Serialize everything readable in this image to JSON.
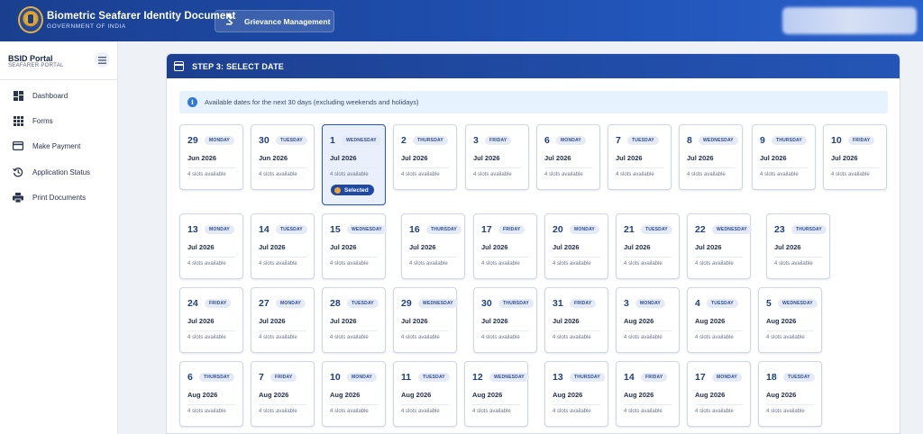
{
  "header": {
    "title": "Biometric Seafarer Identity Document",
    "subtitle": "GOVERNMENT OF INDIA",
    "grievance_label": "Grievance Management"
  },
  "sidebar": {
    "portal_name": "BSID Portal",
    "portal_sub": "SEAFARER PORTAL",
    "items": [
      {
        "label": "Dashboard",
        "icon": "dashboard-icon"
      },
      {
        "label": "Forms",
        "icon": "grid-icon"
      },
      {
        "label": "Make Payment",
        "icon": "credit-card-icon"
      },
      {
        "label": "Application Status",
        "icon": "history-icon"
      },
      {
        "label": "Print Documents",
        "icon": "printer-icon"
      }
    ]
  },
  "main": {
    "step_title": "STEP 3: SELECT DATE",
    "info_text": "Available dates for the next 30 days (excluding weekends and holidays)",
    "selected_label": "Selected",
    "accent_color": "#1f4aa3",
    "dates": [
      {
        "day": "29",
        "weekday": "MONDAY",
        "month": "Jun 2026",
        "slots": "4 slots available"
      },
      {
        "day": "30",
        "weekday": "TUESDAY",
        "month": "Jun 2026",
        "slots": "4 slots available"
      },
      {
        "day": "1",
        "weekday": "WEDNESDAY",
        "month": "Jul 2026",
        "slots": "4 slots available",
        "selected": true
      },
      {
        "day": "2",
        "weekday": "THURSDAY",
        "month": "Jul 2026",
        "slots": "4 slots available"
      },
      {
        "day": "3",
        "weekday": "FRIDAY",
        "month": "Jul 2026",
        "slots": "4 slots available"
      },
      {
        "day": "6",
        "weekday": "MONDAY",
        "month": "Jul 2026",
        "slots": "4 slots available"
      },
      {
        "day": "7",
        "weekday": "TUESDAY",
        "month": "Jul 2026",
        "slots": "4 slots available"
      },
      {
        "day": "8",
        "weekday": "WEDNESDAY",
        "month": "Jul 2026",
        "slots": "4 slots available"
      },
      {
        "day": "9",
        "weekday": "THURSDAY",
        "month": "Jul 2026",
        "slots": "4 slots available"
      },
      {
        "day": "10",
        "weekday": "FRIDAY",
        "month": "Jul 2026",
        "slots": "4 slots available"
      },
      {
        "day": "13",
        "weekday": "MONDAY",
        "month": "Jul 2026",
        "slots": "4 slots available"
      },
      {
        "day": "14",
        "weekday": "TUESDAY",
        "month": "Jul 2026",
        "slots": "4 slots available"
      },
      {
        "day": "15",
        "weekday": "WEDNESDAY",
        "month": "Jul 2026",
        "slots": "4 slots available"
      },
      {
        "day": "16",
        "weekday": "THURSDAY",
        "month": "Jul 2026",
        "slots": "4 slots available"
      },
      {
        "day": "17",
        "weekday": "FRIDAY",
        "month": "Jul 2026",
        "slots": "4 slots available"
      },
      {
        "day": "20",
        "weekday": "MONDAY",
        "month": "Jul 2026",
        "slots": "4 slots available"
      },
      {
        "day": "21",
        "weekday": "TUESDAY",
        "month": "Jul 2026",
        "slots": "4 slots available"
      },
      {
        "day": "22",
        "weekday": "WEDNESDAY",
        "month": "Jul 2026",
        "slots": "4 slots available"
      },
      {
        "day": "23",
        "weekday": "THURSDAY",
        "month": "Jul 2026",
        "slots": "4 slots available"
      },
      {
        "day": "24",
        "weekday": "FRIDAY",
        "month": "Jul 2026",
        "slots": "4 slots available"
      },
      {
        "day": "27",
        "weekday": "MONDAY",
        "month": "Jul 2026",
        "slots": "4 slots available"
      },
      {
        "day": "28",
        "weekday": "TUESDAY",
        "month": "Jul 2026",
        "slots": "4 slots available"
      },
      {
        "day": "29",
        "weekday": "WEDNESDAY",
        "month": "Jul 2026",
        "slots": "4 slots available"
      },
      {
        "day": "30",
        "weekday": "THURSDAY",
        "month": "Jul 2026",
        "slots": "4 slots available"
      },
      {
        "day": "31",
        "weekday": "FRIDAY",
        "month": "Jul 2026",
        "slots": "4 slots available"
      },
      {
        "day": "3",
        "weekday": "MONDAY",
        "month": "Aug 2026",
        "slots": "4 slots available"
      },
      {
        "day": "4",
        "weekday": "TUESDAY",
        "month": "Aug 2026",
        "slots": "4 slots available"
      },
      {
        "day": "5",
        "weekday": "WEDNESDAY",
        "month": "Aug 2026",
        "slots": "4 slots available"
      },
      {
        "day": "6",
        "weekday": "THURSDAY",
        "month": "Aug 2026",
        "slots": "4 slots available"
      },
      {
        "day": "7",
        "weekday": "FRIDAY",
        "month": "Aug 2026",
        "slots": "4 slots available"
      },
      {
        "day": "10",
        "weekday": "MONDAY",
        "month": "Aug 2026",
        "slots": "4 slots available"
      },
      {
        "day": "11",
        "weekday": "TUESDAY",
        "month": "Aug 2026",
        "slots": "4 slots available"
      },
      {
        "day": "12",
        "weekday": "WEDNESDAY",
        "month": "Aug 2026",
        "slots": "4 slots available"
      },
      {
        "day": "13",
        "weekday": "THURSDAY",
        "month": "Aug 2026",
        "slots": "4 slots available"
      },
      {
        "day": "14",
        "weekday": "FRIDAY",
        "month": "Aug 2026",
        "slots": "4 slots available"
      },
      {
        "day": "17",
        "weekday": "MONDAY",
        "month": "Aug 2026",
        "slots": "4 slots available"
      },
      {
        "day": "18",
        "weekday": "TUESDAY",
        "month": "Aug 2026",
        "slots": "4 slots available"
      }
    ]
  }
}
